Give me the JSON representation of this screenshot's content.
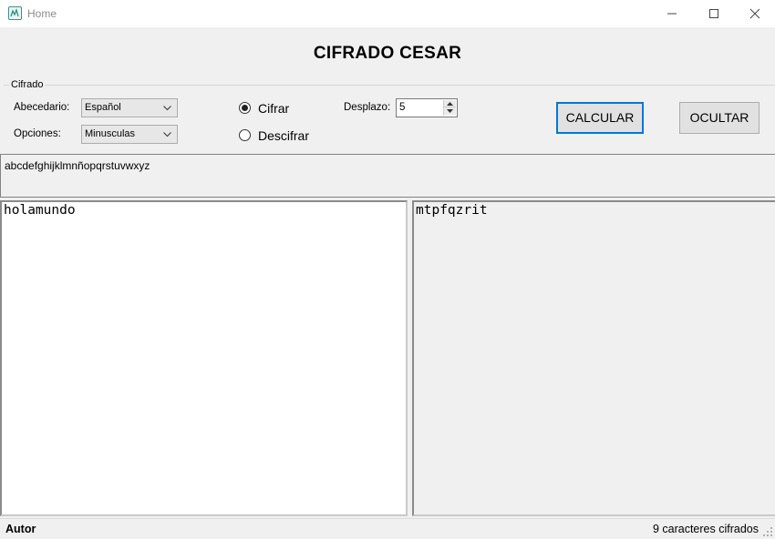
{
  "window": {
    "title": "Home",
    "icon": "app-icon"
  },
  "header": {
    "title": "CIFRADO CESAR"
  },
  "group": {
    "legend": "Cifrado",
    "alphabet_label": "Abecedario:",
    "alphabet_value": "Español",
    "options_label": "Opciones:",
    "options_value": "Minusculas",
    "mode_encrypt": "Cifrar",
    "mode_decrypt": "Descifrar",
    "selected_mode": "Cifrar",
    "shift_label": "Desplazo:",
    "shift_value": "5",
    "calculate_label": "CALCULAR",
    "hide_label": "OCULTAR"
  },
  "alphabet_display": "abcdefghijklmnñopqrstuvwxyz",
  "input_text": "holamundo",
  "output_text": "mtpfqzrit",
  "status": {
    "left": "Autor",
    "right": "9 caracteres cifrados"
  },
  "colors": {
    "accent": "#0078d7",
    "background": "#f0f0f0"
  }
}
